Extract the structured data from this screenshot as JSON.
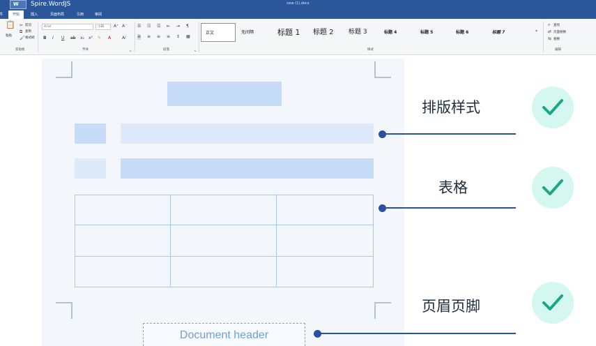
{
  "titlebar": {
    "logo_text": "W",
    "app_name": "Spire.WordJS",
    "doc_name": "new (1).docx"
  },
  "tabs": [
    {
      "label": "文件"
    },
    {
      "label": "开始"
    },
    {
      "label": "插入"
    },
    {
      "label": "页面布局"
    },
    {
      "label": "引用"
    },
    {
      "label": "审阅"
    }
  ],
  "ribbon": {
    "clipboard": {
      "paste": "粘贴",
      "cut": "剪切",
      "copy": "复制",
      "format_painter": "格式刷",
      "group": "剪贴板"
    },
    "font": {
      "family": "Arial",
      "size": "小四",
      "group": "字体"
    },
    "paragraph": {
      "group": "段落"
    },
    "styles": {
      "items": [
        "正文",
        "无间隔",
        "标题 1",
        "标题 2",
        "标题 3",
        "标题 4",
        "标题 5",
        "标题 6",
        "标题 7"
      ],
      "group": "样式"
    },
    "editing": {
      "find": "查找",
      "replace_text": "页面替换",
      "replace": "替换",
      "group": "编辑"
    }
  },
  "illustration": {
    "features": [
      {
        "label": "排版样式"
      },
      {
        "label": "表格"
      },
      {
        "label": "页眉页脚"
      }
    ],
    "doc_header_text": "Document header"
  },
  "colors": {
    "titlebar": "#2b579a",
    "accent": "#2b4fa3",
    "check_bg": "#d4f7ef",
    "check_mark": "#1ea882",
    "block_light": "#ddeafb",
    "block_mid": "#c6dcf8"
  }
}
